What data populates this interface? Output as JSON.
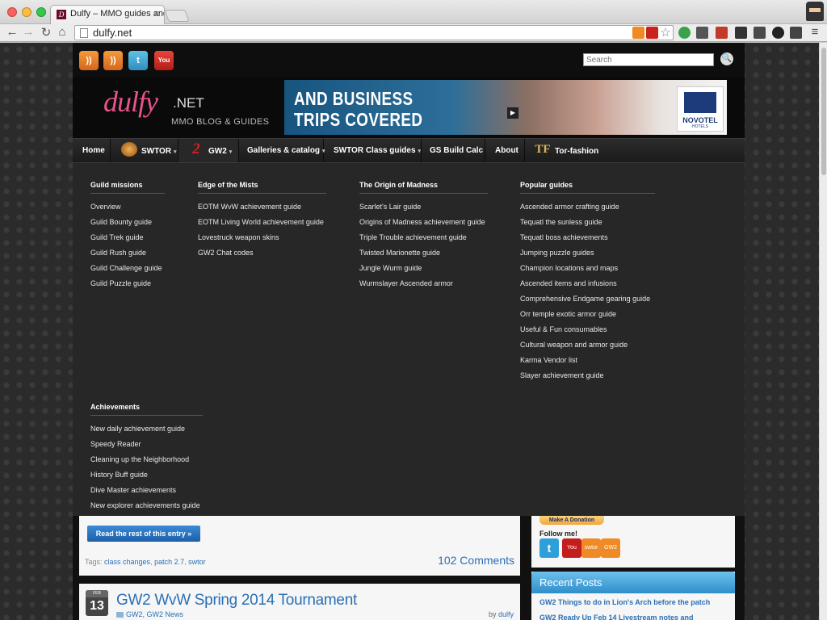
{
  "browser": {
    "tab_title": "Dulfy – MMO guides and n",
    "tab_favicon": "D",
    "tab_close": "×",
    "url": "dulfy.net",
    "buttons": {
      "back": "←",
      "forward": "→",
      "reload": "↻",
      "home": "⌂",
      "star": "☆",
      "menu": "≡"
    }
  },
  "site": {
    "search_placeholder": "Search",
    "search_button_icon": "🔍",
    "logo": {
      "main": "dulfy",
      "suffix": ".NET",
      "tagline": "MMO BLOG & GUIDES"
    },
    "ad": {
      "line1": "AND BUSINESS",
      "line2": "TRIPS COVERED",
      "brand": "NOVOTEL",
      "brand_sub": "HOTELS"
    },
    "social": {
      "rss": "RSS",
      "twitter": "t",
      "youtube": "You Tube"
    },
    "nav": [
      {
        "label": "Home"
      },
      {
        "label": "SWTOR",
        "caret": "▾"
      },
      {
        "label": "GW2",
        "caret": "▾"
      },
      {
        "label": "Galleries & catalog",
        "caret": "▾"
      },
      {
        "label": "SWTOR Class guides",
        "caret": "▾"
      },
      {
        "label": "GS Build Calc"
      },
      {
        "label": "About"
      },
      {
        "label": "Tor-fashion"
      }
    ],
    "nav_icons": {
      "gw2": "2",
      "torfashion": "TF"
    },
    "mega": {
      "guild_missions": {
        "title": "Guild missions",
        "links": [
          "Overview",
          "Guild Bounty guide",
          "Guild Trek guide",
          "Guild Rush guide",
          "Guild Challenge guide",
          "Guild Puzzle guide"
        ]
      },
      "edge_of_mists": {
        "title": "Edge of the Mists",
        "links": [
          "EOTM WvW achievement guide",
          "EOTM Living World achievement guide",
          "Lovestruck weapon skins",
          "GW2 Chat codes"
        ]
      },
      "origin_madness": {
        "title": "The Origin of Madness",
        "links": [
          "Scarlet's Lair guide",
          "Origins of Madness achievement guide",
          "Triple Trouble achievement guide",
          "Twisted Marionette guide",
          "Jungle Wurm guide",
          "Wurmslayer Ascended armor"
        ]
      },
      "popular": {
        "title": "Popular guides",
        "links": [
          "Ascended armor crafting guide",
          "Tequatl the sunless guide",
          "Tequatl boss achievements",
          "Jumping puzzle guides",
          "Champion locations and maps",
          "Ascended items and infusions",
          "Comprehensive Endgame gearing guide",
          "Orr temple exotic armor guide",
          "Useful & Fun consumables",
          "Cultural weapon and armor guide",
          "Karma Vendor list",
          "Slayer achievement guide"
        ]
      },
      "achievements": {
        "title": "Achievements",
        "links": [
          "New daily achievement guide",
          "Speedy Reader",
          "Cleaning up the Neighborhood",
          "History Buff guide",
          "Dive Master achievements",
          "New explorer achievements guide"
        ]
      }
    },
    "post1": {
      "read_more": "Read the rest of this entry »",
      "tags_label": "Tags: ",
      "tags": [
        "class changes",
        "patch 2.7",
        "swtor"
      ],
      "comments": "102 Comments"
    },
    "post2": {
      "month": "FEB",
      "day": "13",
      "title": "GW2 WvW Spring 2014 Tournament",
      "categories": "GW2, GW2 News",
      "by_label": "by ",
      "author": "dulfy"
    },
    "sidebar": {
      "donate": "Make A Donation",
      "follow": "Follow me!",
      "icons": {
        "twitter": "t",
        "youtube": "You",
        "rss1": "swtor",
        "rss2": "GW2"
      },
      "recent_title": "Recent Posts",
      "recent_links": [
        "GW2 Things to do in Lion's Arch before the patch",
        "GW2 Ready Up Feb 14 Livestream notes and"
      ]
    }
  },
  "colors": {
    "accent_pink": "#e8538c",
    "link_blue": "#2a6fb5",
    "menu_bg": "#272727"
  }
}
